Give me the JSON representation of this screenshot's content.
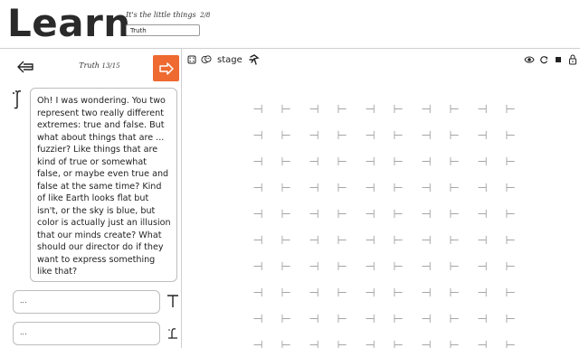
{
  "app": {
    "logo": "Learn",
    "lesson_title": "It's the little things",
    "lesson_progress": "2/8",
    "section_value": "Truth"
  },
  "nav": {
    "chapter_title": "Truth",
    "chapter_progress": "13/15",
    "back_icon": "arrow-left-icon",
    "next_icon": "arrow-right-icon",
    "accent_color": "#ee6a30"
  },
  "dialogue": {
    "speaker_icon": "speaker-f-icon",
    "message": "Oh! I was wondering. You two represent two really different extremes: true and false. But what about things that are ... fuzzier? Like things that are kind of true or somewhat false, or maybe even true and false at the same time? Kind of like Earth looks flat but isn't, or the sky is blue, but color is actually just an illusion that our minds create? What should our director do if they want to express something like that?",
    "replies": [
      {
        "text": "...",
        "icon": "true-tee-icon"
      },
      {
        "text": "...",
        "icon": "speaker-f-icon"
      }
    ]
  },
  "stage": {
    "label": "stage",
    "left_tools": [
      "fullscreen-icon",
      "actors-icon",
      "director-icon"
    ],
    "right_tools": [
      "eye-icon",
      "refresh-icon",
      "stop-icon",
      "lock-icon"
    ],
    "grid_symbols": [
      "⊣",
      "⊢"
    ]
  }
}
